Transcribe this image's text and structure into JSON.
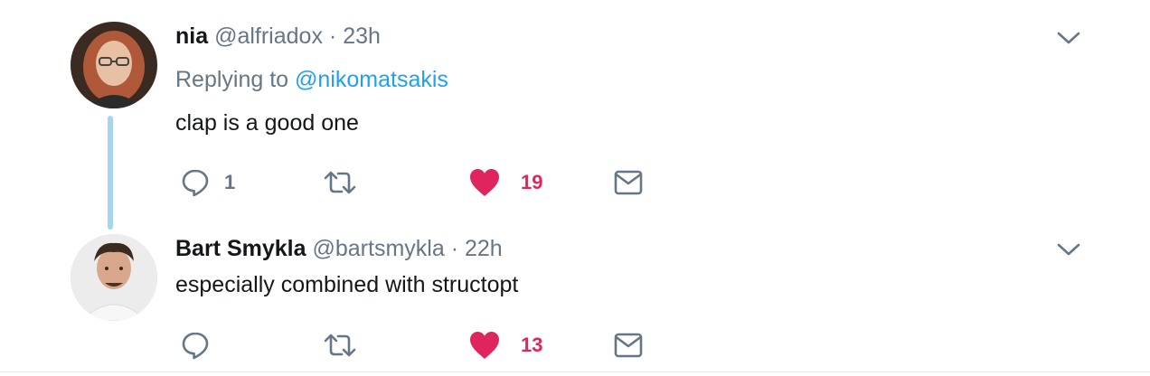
{
  "tweets": [
    {
      "name": "nia",
      "handle": "@alfriadox",
      "separator": "·",
      "time": "23h",
      "replying_prefix": "Replying to",
      "replying_to": "@nikomatsakis",
      "text": "clap is a good one",
      "reply_count": "1",
      "retweet_count": "",
      "like_count": "19"
    },
    {
      "name": "Bart Smykla",
      "handle": "@bartsmykla",
      "separator": "·",
      "time": "22h",
      "text": "especially combined with structopt",
      "reply_count": "",
      "retweet_count": "",
      "like_count": "13"
    }
  ],
  "colors": {
    "accent_blue": "#1da1f2",
    "like_red": "#e0245e",
    "secondary_gray": "#657786",
    "thread_line": "#a6d5f1"
  },
  "icons": [
    "reply-icon",
    "retweet-icon",
    "heart-icon",
    "envelope-icon",
    "chevron-down-icon"
  ]
}
